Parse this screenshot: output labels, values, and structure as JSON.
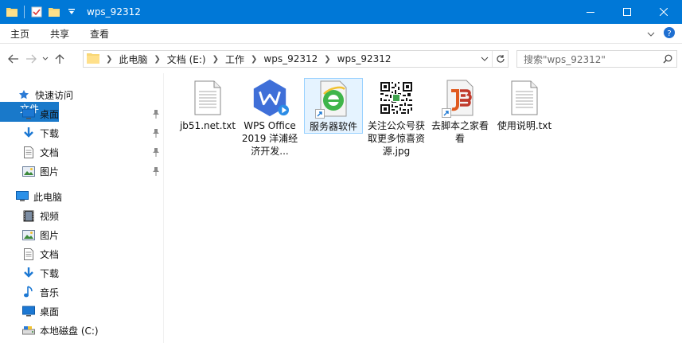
{
  "window": {
    "title": "wps_92312",
    "controls": {
      "minimize": "minimize-icon",
      "maximize": "maximize-icon",
      "close": "close-icon"
    }
  },
  "ribbon": {
    "tabs": [
      {
        "label": "文件"
      },
      {
        "label": "主页"
      },
      {
        "label": "共享"
      },
      {
        "label": "查看"
      }
    ]
  },
  "address": {
    "breadcrumbs": [
      "此电脑",
      "文档 (E:)",
      "工作",
      "wps_92312",
      "wps_92312"
    ]
  },
  "search": {
    "placeholder": "搜索\"wps_92312\""
  },
  "sidebar": {
    "quick_access": {
      "label": "快速访问",
      "items": [
        {
          "label": "桌面",
          "icon": "desktop-icon",
          "pinned": true
        },
        {
          "label": "下载",
          "icon": "download-icon",
          "pinned": true
        },
        {
          "label": "文档",
          "icon": "document-icon",
          "pinned": true
        },
        {
          "label": "图片",
          "icon": "picture-icon",
          "pinned": true
        }
      ]
    },
    "this_pc": {
      "label": "此电脑",
      "items": [
        {
          "label": "视频",
          "icon": "video-icon"
        },
        {
          "label": "图片",
          "icon": "picture-icon"
        },
        {
          "label": "文档",
          "icon": "document-icon"
        },
        {
          "label": "下载",
          "icon": "download-icon"
        },
        {
          "label": "音乐",
          "icon": "music-icon"
        },
        {
          "label": "桌面",
          "icon": "desktop-icon"
        },
        {
          "label": "本地磁盘 (C:)",
          "icon": "drive-icon"
        }
      ]
    }
  },
  "files": [
    {
      "name": "jb51.net.txt",
      "icon": "text-file-icon"
    },
    {
      "name": "WPS Office 2019 洋浦经济开发...",
      "icon": "wps-icon"
    },
    {
      "name": "服务器软件",
      "icon": "ie-shortcut-icon",
      "selected": true
    },
    {
      "name": "关注公众号获取更多惊喜资源.jpg",
      "icon": "qrcode-icon"
    },
    {
      "name": "去脚本之家看看",
      "icon": "jb51-shortcut-icon"
    },
    {
      "name": "使用说明.txt",
      "icon": "text-file-icon"
    }
  ],
  "colors": {
    "titlebar": "#0078d7",
    "file_tab": "#1979ca",
    "selection_bg": "#e5f3ff",
    "selection_border": "#99d1ff"
  }
}
